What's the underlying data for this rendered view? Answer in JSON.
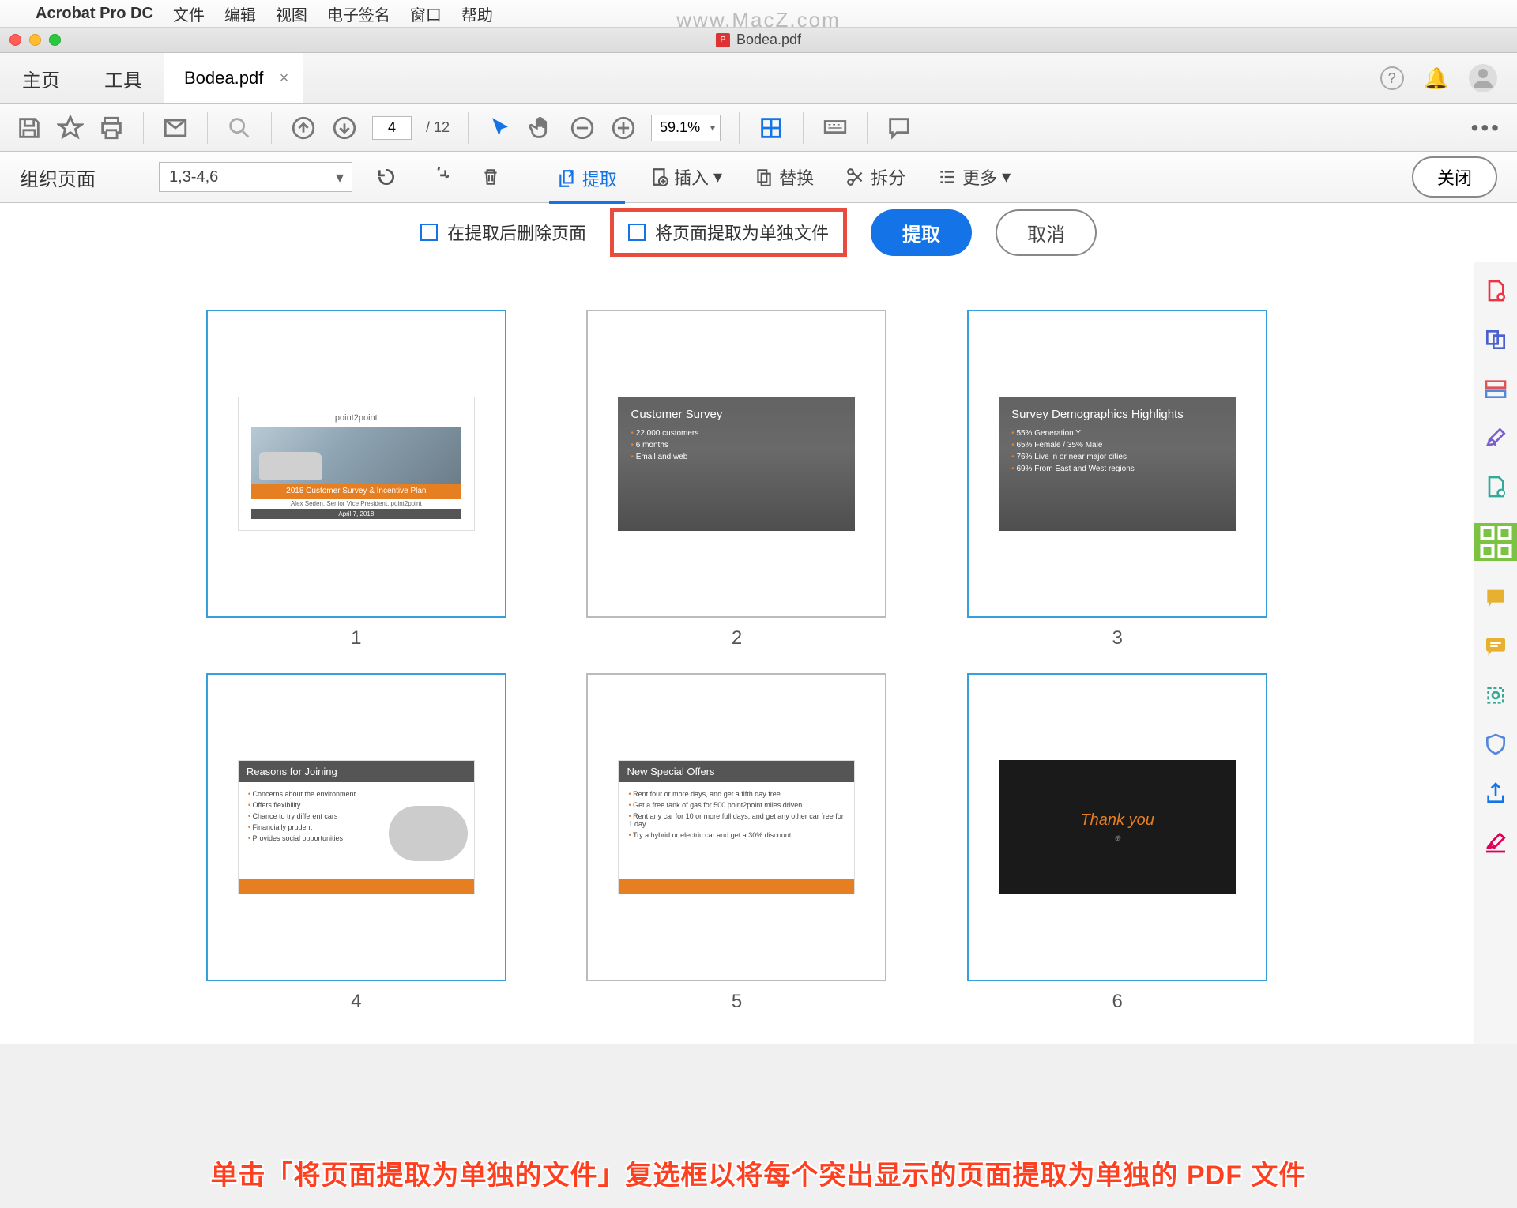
{
  "mac_menu": {
    "app_name": "Acrobat Pro DC",
    "items": [
      "文件",
      "编辑",
      "视图",
      "电子签名",
      "窗口",
      "帮助"
    ]
  },
  "watermark": "www.MacZ.com",
  "window": {
    "title": "Bodea.pdf"
  },
  "tabs": {
    "home": "主页",
    "tools": "工具",
    "active": "Bodea.pdf"
  },
  "toolbar": {
    "page_current": "4",
    "page_total": "/ 12",
    "zoom": "59.1%"
  },
  "org_bar": {
    "title": "组织页面",
    "range": "1,3-4,6",
    "extract": "提取",
    "insert": "插入",
    "replace": "替换",
    "split": "拆分",
    "more": "更多",
    "close": "关闭"
  },
  "extract_opts": {
    "delete_after": "在提取后删除页面",
    "as_separate": "将页面提取为单独文件",
    "extract_btn": "提取",
    "cancel_btn": "取消"
  },
  "slides": {
    "s1": {
      "logo": "point2point",
      "title": "2018 Customer Survey & Incentive Plan",
      "author": "Alex Seden, Senior Vice President, point2point",
      "date": "April 7, 2018"
    },
    "s2": {
      "title": "Customer Survey",
      "b1": "22,000 customers",
      "b2": "6 months",
      "b3": "Email and web"
    },
    "s3": {
      "title": "Survey Demographics Highlights",
      "b1": "55% Generation Y",
      "b2": "65% Female / 35% Male",
      "b3": "76% Live in or near major cities",
      "b4": "69% From East and West regions"
    },
    "s4": {
      "title": "Reasons for Joining",
      "b1": "Concerns about the environment",
      "b2": "Offers flexibility",
      "b3": "Chance to try different cars",
      "b4": "Financially prudent",
      "b5": "Provides social opportunities"
    },
    "s5": {
      "title": "New Special Offers",
      "b1": "Rent four or more days, and get a fifth day free",
      "b2": "Get a free tank of gas for 500 point2point miles driven",
      "b3": "Rent any car for 10 or more full days, and get any other car free for 1 day",
      "b4": "Try a hybrid or electric car and get a 30% discount"
    },
    "s6": {
      "title": "Thank you"
    },
    "nums": [
      "1",
      "2",
      "3",
      "4",
      "5",
      "6"
    ]
  },
  "annotation": "单击「将页面提取为单独的文件」复选框以将每个突出显示的页面提取为单独的 PDF 文件"
}
